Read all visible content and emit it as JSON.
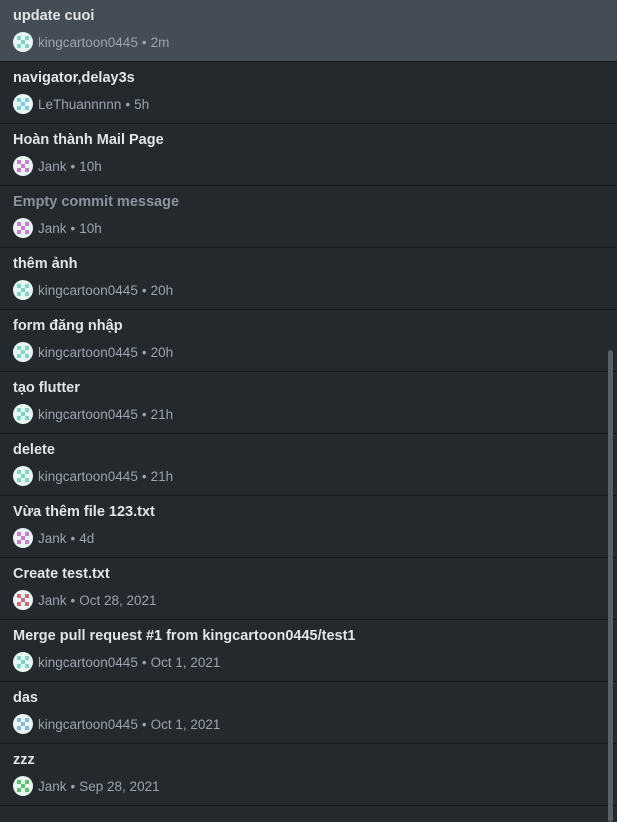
{
  "commits": [
    {
      "summary": "update cuoi",
      "author": "kingcartoon0445",
      "time": "2m",
      "avatar": "teal-icon",
      "color": "#7fd6c4",
      "selected": true,
      "muted": false
    },
    {
      "summary": "navigator,delay3s",
      "author": "LeThuannnnn",
      "time": "5h",
      "avatar": "teal-cross-icon",
      "color": "#78cfe0",
      "selected": false,
      "muted": false
    },
    {
      "summary": "Hoàn thành Mail Page",
      "author": "Jank",
      "time": "10h",
      "avatar": "pink-check-icon",
      "color": "#d07ad2",
      "selected": false,
      "muted": false
    },
    {
      "summary": "Empty commit message",
      "author": "Jank",
      "time": "10h",
      "avatar": "pink-check-icon",
      "color": "#d07ad2",
      "selected": false,
      "muted": true
    },
    {
      "summary": "thêm ảnh",
      "author": "kingcartoon0445",
      "time": "20h",
      "avatar": "teal-icon",
      "color": "#7fd6c4",
      "selected": false,
      "muted": false
    },
    {
      "summary": "form đăng nhập",
      "author": "kingcartoon0445",
      "time": "20h",
      "avatar": "teal-icon",
      "color": "#7fd6c4",
      "selected": false,
      "muted": false
    },
    {
      "summary": "tạo flutter",
      "author": "kingcartoon0445",
      "time": "21h",
      "avatar": "teal-icon",
      "color": "#7fd6c4",
      "selected": false,
      "muted": false
    },
    {
      "summary": "delete",
      "author": "kingcartoon0445",
      "time": "21h",
      "avatar": "teal-icon",
      "color": "#7fd6c4",
      "selected": false,
      "muted": false
    },
    {
      "summary": "Vừa thêm file 123.txt",
      "author": "Jank",
      "time": "4d",
      "avatar": "pink-check-icon",
      "color": "#d07ad2",
      "selected": false,
      "muted": false
    },
    {
      "summary": "Create test.txt",
      "author": "Jank",
      "time": "Oct 28, 2021",
      "avatar": "red-icon",
      "color": "#d46a78",
      "selected": false,
      "muted": false
    },
    {
      "summary": "Merge pull request #1 from kingcartoon0445/test1",
      "author": "kingcartoon0445",
      "time": "Oct 1, 2021",
      "avatar": "teal-icon",
      "color": "#7fd6c4",
      "selected": false,
      "muted": false
    },
    {
      "summary": "das",
      "author": "kingcartoon0445",
      "time": "Oct 1, 2021",
      "avatar": "blue-icon",
      "color": "#8ab8d9",
      "selected": false,
      "muted": false
    },
    {
      "summary": "zzz",
      "author": "Jank",
      "time": "Sep 28, 2021",
      "avatar": "green-icon",
      "color": "#5cc46a",
      "selected": false,
      "muted": false
    }
  ],
  "separator": "•"
}
